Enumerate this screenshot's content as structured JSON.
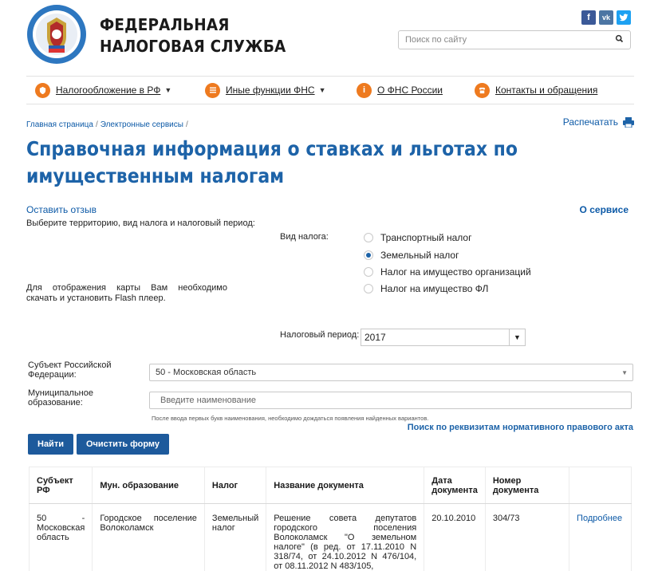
{
  "header": {
    "brand_line1": "ФЕДЕРАЛЬНАЯ",
    "brand_line2": "НАЛОГОВАЯ СЛУЖБА",
    "search_placeholder": "Поиск по сайту",
    "social": [
      {
        "name": "facebook",
        "glyph": "f",
        "color": "#3b5998"
      },
      {
        "name": "vk",
        "glyph": "vk",
        "color": "#4c75a3"
      },
      {
        "name": "twitter",
        "glyph": "t",
        "color": "#1da1f2"
      }
    ]
  },
  "nav": [
    {
      "label": "Налогообложение в РФ",
      "icon": "coat-of-arms-icon",
      "dropdown": true
    },
    {
      "label": "Иные функции ФНС",
      "icon": "menu-icon",
      "dropdown": true
    },
    {
      "label": "О ФНС России",
      "icon": "info-icon",
      "dropdown": false
    },
    {
      "label": "Контакты и обращения",
      "icon": "phone-icon",
      "dropdown": false
    }
  ],
  "breadcrumb": [
    "Главная страница",
    "Электронные сервисы"
  ],
  "print_label": "Распечатать",
  "title_line1": "Справочная информация о ставках и льготах по",
  "title_line2": "имущественным налогам",
  "feedback_label": "Оставить отзыв",
  "about_label": "О сервисе",
  "instruction": "Выберите территорию, вид налога и налоговый период:",
  "tax_type": {
    "label": "Вид налога:",
    "options": [
      "Транспортный налог",
      "Земельный налог",
      "Налог на имущество организаций",
      "Налог на имущество ФЛ"
    ],
    "selected_index": 1
  },
  "flash_notice": "Для отображения карты Вам необходимо скачать и установить Flash плеер.",
  "period": {
    "label": "Налоговый период:",
    "value": "2017"
  },
  "subject": {
    "label_line1": "Субъект Российской",
    "label_line2": "Федерации:",
    "value": "50 - Московская область"
  },
  "municipality": {
    "label_line1": "Муниципальное",
    "label_line2": "образование:",
    "placeholder": "Введите наименование"
  },
  "hint": "После ввода первых букв наименования, необходимо дождаться появления найденных вариантов.",
  "requisites_link": "Поиск по реквизитам нормативного правового акта",
  "buttons": {
    "find": "Найти",
    "clear": "Очистить форму"
  },
  "table": {
    "headers": [
      "Субъект РФ",
      "Мун. образование",
      "Налог",
      "Название документа",
      "Дата документа",
      "Номер документа",
      ""
    ],
    "rows": [
      {
        "subject": "50 - Московская область",
        "municipality": "Городское поселение Волоколамск",
        "tax": "Земельный налог",
        "document": "Решение совета депутатов городского поселения Волоколамск \"О земельном налоге\" (в ред. от 17.11.2010 N 318/74, от 24.10.2012 N 476/104, от 08.11.2012 N 483/105,",
        "date": "20.10.2010",
        "number": "304/73",
        "more": "Подробнее"
      }
    ]
  },
  "colors": {
    "accent": "#1d63a8",
    "nav_icon": "#ee7a1f",
    "button": "#1d5a9c",
    "link": "#0d5aa7"
  }
}
